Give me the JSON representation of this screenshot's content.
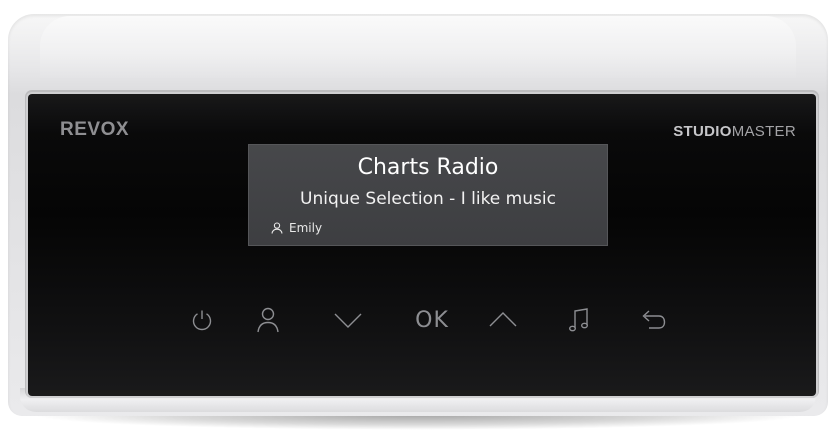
{
  "device": {
    "brand": "REVOX",
    "model_bold": "STUDIO",
    "model_light": "MASTER"
  },
  "display": {
    "title": "Charts Radio",
    "subtitle": "Unique Selection - I like music",
    "user_icon": "user-icon",
    "user": "Emily"
  },
  "controls": [
    {
      "icon": "power-icon"
    },
    {
      "icon": "user-icon"
    },
    {
      "icon": "chevron-down-icon"
    },
    {
      "label": "OK"
    },
    {
      "icon": "chevron-up-icon"
    },
    {
      "icon": "music-note-icon"
    },
    {
      "icon": "back-icon"
    }
  ],
  "colors": {
    "housing": "#e8e8ea",
    "glass": "#080808",
    "display_bg": "#434447",
    "display_text": "#ffffff",
    "control_icons": "#8d8e92"
  }
}
